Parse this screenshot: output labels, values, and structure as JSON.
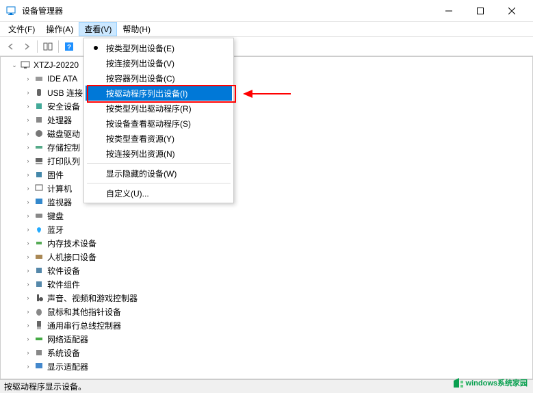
{
  "window": {
    "title": "设备管理器",
    "min": "—",
    "max": "□",
    "close": "✕"
  },
  "menubar": {
    "file": "文件(F)",
    "action": "操作(A)",
    "view": "查看(V)",
    "help": "帮助(H)"
  },
  "dropdown": [
    {
      "label": "按类型列出设备(E)",
      "bullet": true
    },
    {
      "label": "按连接列出设备(V)"
    },
    {
      "label": "按容器列出设备(C)"
    },
    {
      "label": "按驱动程序列出设备(I)",
      "highlighted": true
    },
    {
      "label": "按类型列出驱动程序(R)"
    },
    {
      "label": "按设备查看驱动程序(S)"
    },
    {
      "label": "按类型查看资源(Y)"
    },
    {
      "label": "按连接列出资源(N)"
    },
    {
      "sep": true
    },
    {
      "label": "显示隐藏的设备(W)"
    },
    {
      "sep": true
    },
    {
      "label": "自定义(U)..."
    }
  ],
  "tree": {
    "root": "XTZJ-20220",
    "nodes": [
      {
        "label": "IDE ATA"
      },
      {
        "label": "USB 连接"
      },
      {
        "label": "安全设备"
      },
      {
        "label": "处理器"
      },
      {
        "label": "磁盘驱动"
      },
      {
        "label": "存储控制"
      },
      {
        "label": "打印队列"
      },
      {
        "label": "固件"
      },
      {
        "label": "计算机"
      },
      {
        "label": "监视器"
      },
      {
        "label": "键盘"
      },
      {
        "label": "蓝牙"
      },
      {
        "label": "内存技术设备"
      },
      {
        "label": "人机接口设备"
      },
      {
        "label": "软件设备"
      },
      {
        "label": "软件组件"
      },
      {
        "label": "声音、视频和游戏控制器"
      },
      {
        "label": "鼠标和其他指针设备"
      },
      {
        "label": "通用串行总线控制器"
      },
      {
        "label": "网络适配器"
      },
      {
        "label": "系统设备"
      },
      {
        "label": "显示适配器"
      }
    ]
  },
  "statusbar": "按驱动程序显示设备。",
  "watermark": "windows系统家园"
}
